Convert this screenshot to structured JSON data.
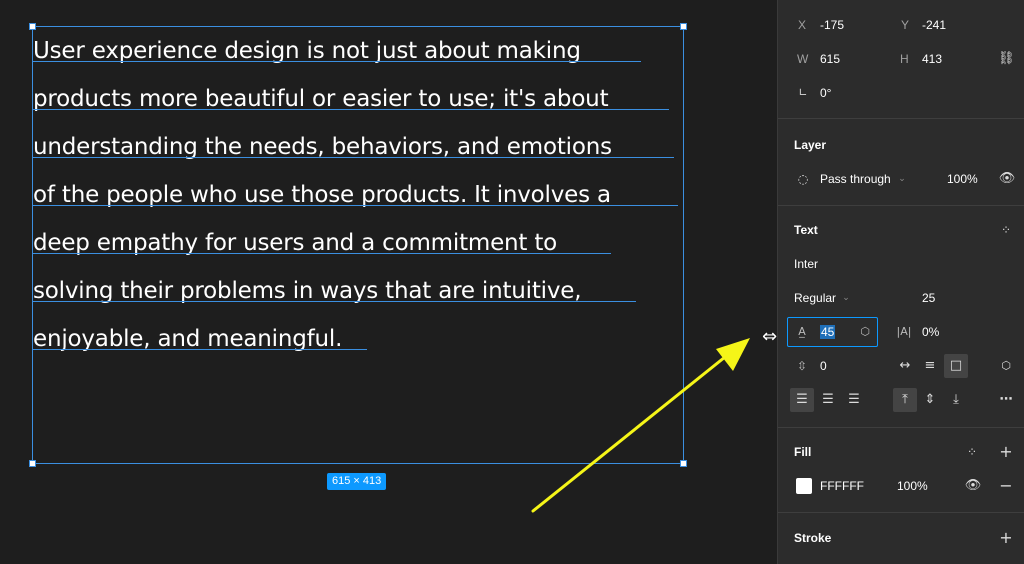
{
  "canvas": {
    "text_lines": [
      "User experience design is not just about making",
      "products more beautiful or easier to use; it's about",
      "understanding the needs, behaviors, and emotions",
      "of the people who use those products. It involves a",
      "deep empathy for users and a commitment to",
      "solving their problems in ways that are intuitive,",
      "enjoyable, and meaningful."
    ],
    "size_badge": "615 × 413",
    "accent": "#3b8fe0",
    "arrow_color": "#f5f518"
  },
  "panel": {
    "x_label": "X",
    "x_value": "-175",
    "y_label": "Y",
    "y_value": "-241",
    "w_label": "W",
    "w_value": "615",
    "h_label": "H",
    "h_value": "413",
    "rotation": "0°",
    "layer": {
      "title": "Layer",
      "blend_mode": "Pass through",
      "opacity": "100%"
    },
    "text": {
      "title": "Text",
      "font_family": "Inter",
      "font_weight": "Regular",
      "font_size": "25",
      "line_height": "45",
      "letter_spacing": "0%",
      "paragraph_spacing": "0"
    },
    "fill": {
      "title": "Fill",
      "hex": "FFFFFF",
      "opacity": "100%",
      "color": "#ffffff"
    },
    "stroke": {
      "title": "Stroke"
    }
  }
}
